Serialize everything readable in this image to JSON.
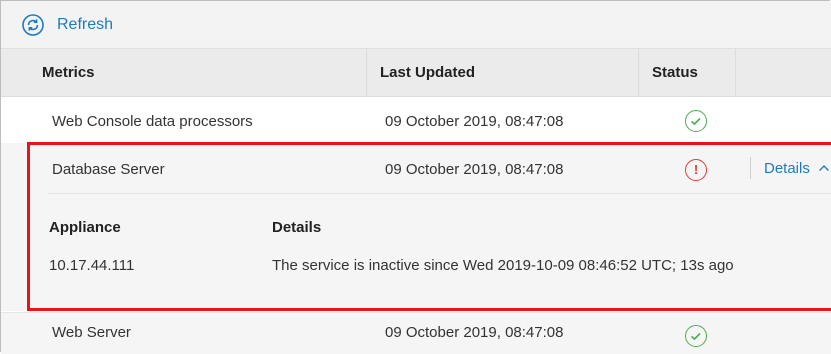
{
  "toolbar": {
    "refresh_label": "Refresh",
    "refresh_icon": "refresh-icon"
  },
  "table": {
    "headers": {
      "metrics": "Metrics",
      "last_updated": "Last Updated",
      "status": "Status"
    },
    "rows": [
      {
        "metric": "Web Console data processors",
        "last_updated": "09 October 2019, 08:47:08",
        "status": "ok"
      },
      {
        "metric": "Database Server",
        "last_updated": "09 October 2019, 08:47:08",
        "status": "error",
        "status_glyph": "!",
        "details_label": "Details",
        "expanded": true
      },
      {
        "metric": "Web Server",
        "last_updated": "09 October 2019, 08:47:08",
        "status": "ok"
      }
    ]
  },
  "details_panel": {
    "headers": {
      "appliance": "Appliance",
      "details": "Details"
    },
    "entries": [
      {
        "appliance": "10.17.44.111",
        "details": "The service is inactive since Wed 2019-10-09 08:46:52 UTC; 13s ago"
      }
    ]
  },
  "colors": {
    "link": "#1e7bc1",
    "ok": "#4caf50",
    "error": "#e53935",
    "highlight_box": "#e8131b"
  }
}
